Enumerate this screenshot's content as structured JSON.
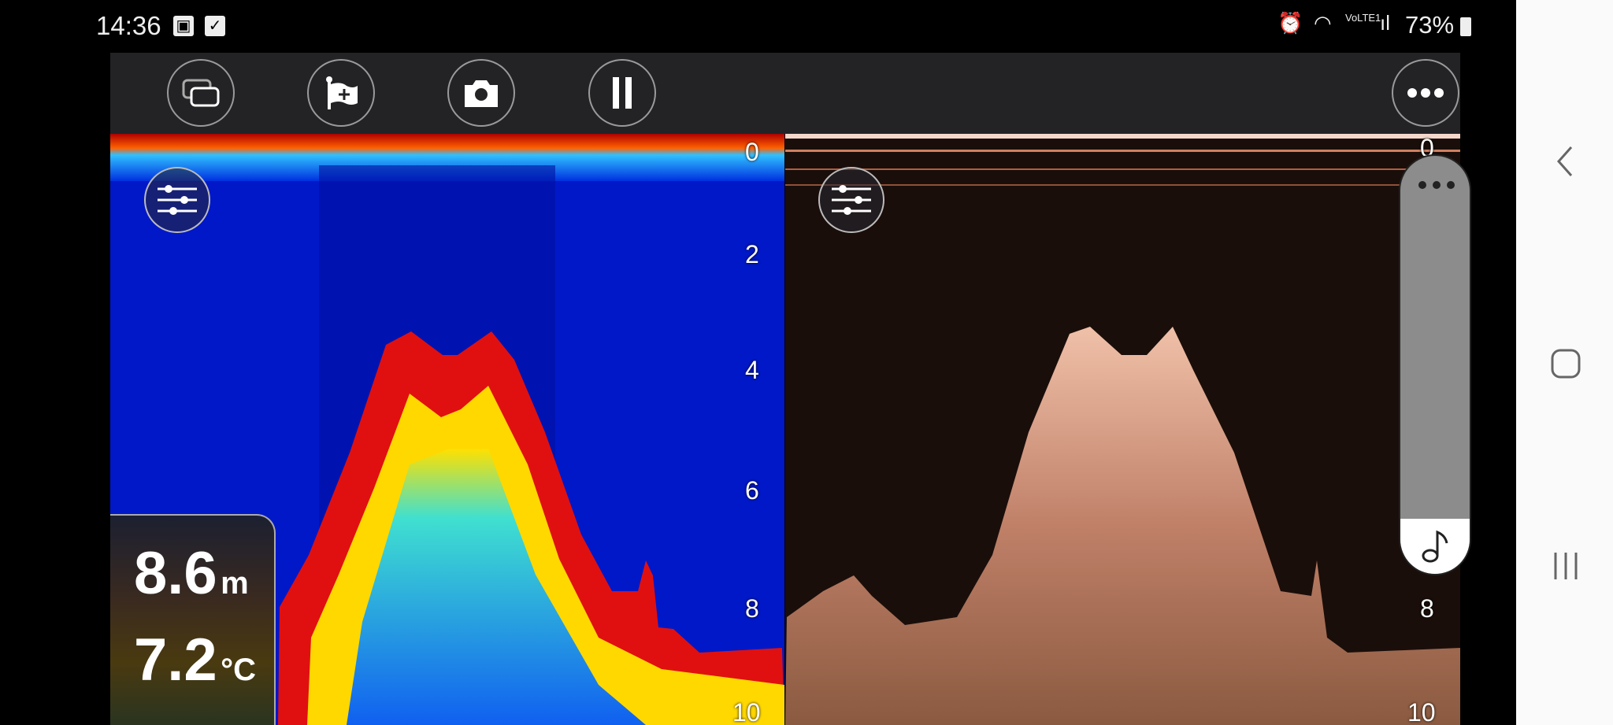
{
  "status_bar": {
    "time": "14:36",
    "battery": "73%",
    "network": "VoLTE1",
    "icons": [
      "gallery-icon",
      "checkbox-icon",
      "alarm-icon",
      "wifi-icon",
      "signal-icon",
      "battery-icon"
    ]
  },
  "toolbar": {
    "buttons": [
      "split-view",
      "add-waypoint",
      "screenshot",
      "pause",
      "more"
    ]
  },
  "left_panel": {
    "palette": "color",
    "scale": [
      "0",
      "2",
      "4",
      "6",
      "8",
      "10"
    ]
  },
  "right_panel": {
    "palette": "sepia",
    "scale": [
      "0",
      "8",
      "10"
    ]
  },
  "readout": {
    "depth_value": "8.6",
    "depth_unit": "m",
    "temp_value": "7.2",
    "temp_unit": "°C"
  },
  "colors": {
    "toolbar": "#232326",
    "left_bg": "#0018c8",
    "right_bg": "#1a0e0a"
  }
}
